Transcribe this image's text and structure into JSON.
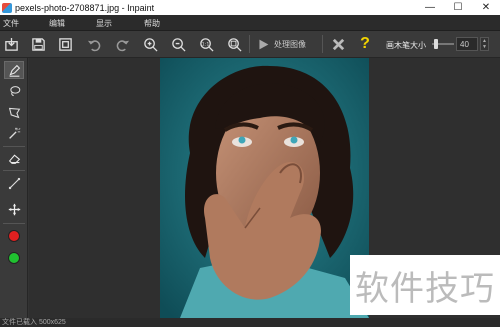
{
  "window": {
    "title": "pexels-photo-2708871.jpg - Inpaint",
    "minimize_glyph": "—",
    "maximize_glyph": "☐",
    "close_glyph": "✕"
  },
  "menu": {
    "items": [
      "文件",
      "编辑",
      "显示",
      "帮助"
    ]
  },
  "toolbar": {
    "process_label": "处理图像",
    "brush_size_label": "画木笔大小",
    "brush_size_value": "40",
    "brush_size_fraction": 0.1,
    "help_glyph": "?",
    "icons": [
      "import-icon",
      "save-icon",
      "save-as-icon",
      "undo-icon",
      "redo-icon",
      "zoom-in-icon",
      "zoom-out-icon",
      "actual-size-icon",
      "fit-window-icon",
      "play-icon",
      "cancel-x-icon",
      "help-icon"
    ]
  },
  "tools": {
    "icons": [
      "marker-icon",
      "lasso-icon",
      "polygon-lasso-icon",
      "magic-wand-icon",
      "eraser-icon",
      "guide-line-icon",
      "move-icon"
    ],
    "colors": [
      "#e02020",
      "#20c030"
    ]
  },
  "status": {
    "text": "文件已载入  500x625"
  },
  "watermark": {
    "text": "软件技巧"
  },
  "colors": {
    "accent_yellow": "#f2d400",
    "cancel_gray": "#bbbbbb",
    "photo_background": "#1b6d78"
  }
}
